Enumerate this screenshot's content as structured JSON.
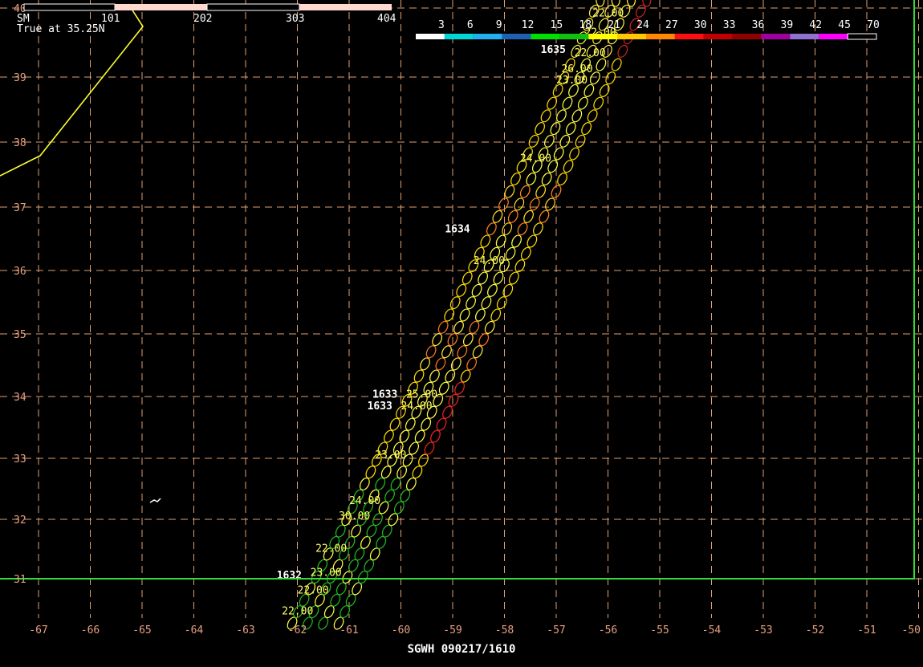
{
  "title": "SGWH 090217/1610",
  "scale_bar": {
    "unit": "SM",
    "ticks": [
      "101",
      "202",
      "303",
      "404"
    ],
    "true_at": "True at 35.25N"
  },
  "axes": {
    "lat_labels": [
      "40",
      "39",
      "38",
      "37",
      "36",
      "35",
      "34",
      "33",
      "32",
      "31"
    ],
    "lon_labels": [
      "-67",
      "-66",
      "-65",
      "-64",
      "-63",
      "-62",
      "-61",
      "-60",
      "-59",
      "-58",
      "-57",
      "-56",
      "-55",
      "-54",
      "-53",
      "-52",
      "-51",
      "-50"
    ]
  },
  "legend": {
    "labels": [
      "3",
      "6",
      "9",
      "12",
      "15",
      "18",
      "21",
      "24",
      "27",
      "30",
      "33",
      "36",
      "39",
      "42",
      "45",
      "70"
    ],
    "colors": [
      "#ffffff",
      "#00d8d8",
      "#20b0f0",
      "#2060b0",
      "#00e000",
      "#10c010",
      "#ffff00",
      "#ffc800",
      "#ff8800",
      "#ff1010",
      "#c00000",
      "#900000",
      "#a000a0",
      "#9070d0",
      "#ff00ff",
      "#000000"
    ]
  },
  "track_times": [
    {
      "text": "1635",
      "lon": -57.3,
      "lat": 39.35
    },
    {
      "text": "1634",
      "lon": -59.15,
      "lat": 36.6
    },
    {
      "text": "1633",
      "lon": -60.55,
      "lat": 33.98
    },
    {
      "text": "1633",
      "lon": -60.65,
      "lat": 33.79
    },
    {
      "text": "1632",
      "lon": -62.4,
      "lat": 31.0
    }
  ],
  "swath_labels": [
    {
      "text": "23.00",
      "lon": -56.2,
      "lat": 40.1
    },
    {
      "text": "22.00",
      "lon": -56.3,
      "lat": 39.88
    },
    {
      "text": "22.00",
      "lon": -56.45,
      "lat": 39.6
    },
    {
      "text": "22.00",
      "lon": -56.65,
      "lat": 39.3
    },
    {
      "text": "26.00",
      "lon": -56.9,
      "lat": 39.07
    },
    {
      "text": "23.00",
      "lon": -57.0,
      "lat": 38.9
    },
    {
      "text": "24.00",
      "lon": -57.7,
      "lat": 37.7
    },
    {
      "text": "24.00",
      "lon": -58.6,
      "lat": 36.1
    },
    {
      "text": "25.00",
      "lon": -59.9,
      "lat": 33.98
    },
    {
      "text": "24.00",
      "lon": -60.0,
      "lat": 33.79
    },
    {
      "text": "23.00",
      "lon": -60.5,
      "lat": 33.0
    },
    {
      "text": "24.00",
      "lon": -61.0,
      "lat": 32.25
    },
    {
      "text": "30.00",
      "lon": -61.2,
      "lat": 32.0
    },
    {
      "text": "22.00",
      "lon": -61.65,
      "lat": 31.45
    },
    {
      "text": "23.00",
      "lon": -61.75,
      "lat": 31.05
    },
    {
      "text": "22.00",
      "lon": -62.0,
      "lat": 30.75
    },
    {
      "text": "22.00",
      "lon": -62.3,
      "lat": 30.4
    }
  ]
}
